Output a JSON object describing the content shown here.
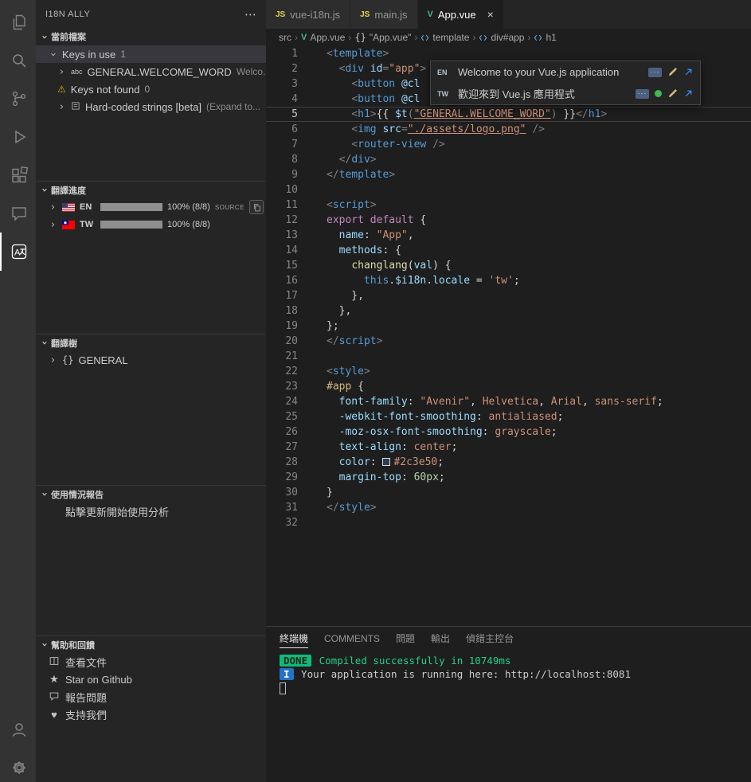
{
  "icons": {
    "chevron": "›",
    "more": "⋯",
    "close": "×",
    "warning": "⚠",
    "star": "★",
    "heart": "♥",
    "braces": "{}",
    "string_symbol": "abc",
    "dots": "···"
  },
  "sidebar": {
    "title": "I18N ALLY",
    "sections": {
      "current_file": {
        "title": "當前檔案",
        "keys_in_use": {
          "label": "Keys in use",
          "count": "1"
        },
        "key": {
          "label": "GENERAL.WELCOME_WORD",
          "desc": "Welco..."
        },
        "keys_not_found": {
          "label": "Keys not found",
          "count": "0"
        },
        "hardcoded": {
          "label": "Hard-coded strings [beta]",
          "desc": "(Expand to..."
        }
      },
      "progress": {
        "title": "翻譯進度",
        "en": {
          "code": "EN",
          "value": "100% (8/8)",
          "tag": "SOURCE"
        },
        "tw": {
          "code": "TW",
          "value": "100% (8/8)"
        }
      },
      "tree": {
        "title": "翻譯樹",
        "root_label": "GENERAL"
      },
      "usage": {
        "title": "使用情況報告",
        "hint": "點擊更新開始使用分析"
      },
      "help": {
        "title": "幫助和回饋",
        "docs": "查看文件",
        "star": "Star on Github",
        "issue": "報告問題",
        "support": "支持我們"
      }
    }
  },
  "editor_tabs": [
    {
      "label": "vue-i18n.js",
      "badge": "JS"
    },
    {
      "label": "main.js",
      "badge": "JS"
    },
    {
      "label": "App.vue",
      "badge": "V"
    }
  ],
  "breadcrumb": [
    "src",
    "App.vue",
    "\"App.vue\"",
    "template",
    "div#app",
    "h1"
  ],
  "popup": {
    "rows": [
      {
        "locale": "EN",
        "text": "Welcome to your Vue.js application"
      },
      {
        "locale": "TW",
        "text": "歡迎來到 Vue.js 應用程式"
      }
    ]
  },
  "editor": {
    "active_line": 5,
    "lines": [
      [
        [
          "pu",
          "<"
        ],
        [
          "tg",
          "template"
        ],
        [
          "pu",
          ">"
        ]
      ],
      [
        [
          "tx",
          "  "
        ],
        [
          "pu",
          "<"
        ],
        [
          "tg",
          "div"
        ],
        [
          "tx",
          " "
        ],
        [
          "at",
          "id"
        ],
        [
          "pu",
          "="
        ],
        [
          "st",
          "\"app\""
        ],
        [
          "pu",
          ">"
        ]
      ],
      [
        [
          "tx",
          "    "
        ],
        [
          "pu",
          "<"
        ],
        [
          "tg",
          "button"
        ],
        [
          "tx",
          " "
        ],
        [
          "at",
          "@cl"
        ]
      ],
      [
        [
          "tx",
          "    "
        ],
        [
          "pu",
          "<"
        ],
        [
          "tg",
          "button"
        ],
        [
          "tx",
          " "
        ],
        [
          "at",
          "@cl"
        ]
      ],
      [
        [
          "tx",
          "    "
        ],
        [
          "pu",
          "<"
        ],
        [
          "tg",
          "h1"
        ],
        [
          "pu",
          ">"
        ],
        [
          "tx",
          "{{ "
        ],
        [
          "at",
          "$t"
        ],
        [
          "pu",
          "("
        ],
        [
          "ku",
          "\"GENERAL.WELCOME_WORD\""
        ],
        [
          "pu",
          ")"
        ],
        [
          "tx",
          " }}"
        ],
        [
          "pu",
          "</"
        ],
        [
          "tg",
          "h1"
        ],
        [
          "pu",
          ">"
        ]
      ],
      [
        [
          "tx",
          "    "
        ],
        [
          "pu",
          "<"
        ],
        [
          "tg",
          "img"
        ],
        [
          "tx",
          " "
        ],
        [
          "at",
          "src"
        ],
        [
          "pu",
          "="
        ],
        [
          "su",
          "\"./assets/logo.png\""
        ],
        [
          "tx",
          " "
        ],
        [
          "pu",
          "/>"
        ]
      ],
      [
        [
          "tx",
          "    "
        ],
        [
          "pu",
          "<"
        ],
        [
          "tg",
          "router-view"
        ],
        [
          "tx",
          " "
        ],
        [
          "pu",
          "/>"
        ]
      ],
      [
        [
          "tx",
          "  "
        ],
        [
          "pu",
          "</"
        ],
        [
          "tg",
          "div"
        ],
        [
          "pu",
          ">"
        ]
      ],
      [
        [
          "pu",
          "</"
        ],
        [
          "tg",
          "template"
        ],
        [
          "pu",
          ">"
        ]
      ],
      [],
      [
        [
          "pu",
          "<"
        ],
        [
          "tg",
          "script"
        ],
        [
          "pu",
          ">"
        ]
      ],
      [
        [
          "kw",
          "export"
        ],
        [
          "tx",
          " "
        ],
        [
          "kw",
          "default"
        ],
        [
          "tx",
          " {"
        ]
      ],
      [
        [
          "tx",
          "  "
        ],
        [
          "at",
          "name"
        ],
        [
          "tx",
          ": "
        ],
        [
          "st",
          "\"App\""
        ],
        [
          "tx",
          ","
        ]
      ],
      [
        [
          "tx",
          "  "
        ],
        [
          "at",
          "methods"
        ],
        [
          "tx",
          ": {"
        ]
      ],
      [
        [
          "tx",
          "    "
        ],
        [
          "fn",
          "changlang"
        ],
        [
          "tx",
          "("
        ],
        [
          "at",
          "val"
        ],
        [
          "tx",
          ") {"
        ]
      ],
      [
        [
          "tx",
          "      "
        ],
        [
          "kb",
          "this"
        ],
        [
          "tx",
          "."
        ],
        [
          "at",
          "$i18n"
        ],
        [
          "tx",
          "."
        ],
        [
          "at",
          "locale"
        ],
        [
          "tx",
          " = "
        ],
        [
          "st",
          "'tw'"
        ],
        [
          "tx",
          ";"
        ]
      ],
      [
        [
          "tx",
          "    },"
        ]
      ],
      [
        [
          "tx",
          "  },"
        ]
      ],
      [
        [
          "tx",
          "};"
        ]
      ],
      [
        [
          "pu",
          "</"
        ],
        [
          "tg",
          "script"
        ],
        [
          "pu",
          ">"
        ]
      ],
      [],
      [
        [
          "pu",
          "<"
        ],
        [
          "tg",
          "style"
        ],
        [
          "pu",
          ">"
        ]
      ],
      [
        [
          "se",
          "#app"
        ],
        [
          "tx",
          " {"
        ]
      ],
      [
        [
          "tx",
          "  "
        ],
        [
          "at",
          "font-family"
        ],
        [
          "tx",
          ": "
        ],
        [
          "st",
          "\"Avenir\""
        ],
        [
          "tx",
          ", "
        ],
        [
          "st",
          "Helvetica"
        ],
        [
          "tx",
          ", "
        ],
        [
          "st",
          "Arial"
        ],
        [
          "tx",
          ", "
        ],
        [
          "st",
          "sans-serif"
        ],
        [
          "tx",
          ";"
        ]
      ],
      [
        [
          "tx",
          "  "
        ],
        [
          "at",
          "-webkit-font-smoothing"
        ],
        [
          "tx",
          ": "
        ],
        [
          "st",
          "antialiased"
        ],
        [
          "tx",
          ";"
        ]
      ],
      [
        [
          "tx",
          "  "
        ],
        [
          "at",
          "-moz-osx-font-smoothing"
        ],
        [
          "tx",
          ": "
        ],
        [
          "st",
          "grayscale"
        ],
        [
          "tx",
          ";"
        ]
      ],
      [
        [
          "tx",
          "  "
        ],
        [
          "at",
          "text-align"
        ],
        [
          "tx",
          ": "
        ],
        [
          "st",
          "center"
        ],
        [
          "tx",
          ";"
        ]
      ],
      [
        [
          "tx",
          "  "
        ],
        [
          "at",
          "color"
        ],
        [
          "tx",
          ": "
        ],
        [
          "sw",
          ""
        ],
        [
          "st",
          "#2c3e50"
        ],
        [
          "tx",
          ";"
        ]
      ],
      [
        [
          "tx",
          "  "
        ],
        [
          "at",
          "margin-top"
        ],
        [
          "tx",
          ": "
        ],
        [
          "nu",
          "60px"
        ],
        [
          "tx",
          ";"
        ]
      ],
      [
        [
          "tx",
          "}"
        ]
      ],
      [
        [
          "pu",
          "</"
        ],
        [
          "tg",
          "style"
        ],
        [
          "pu",
          ">"
        ]
      ],
      []
    ]
  },
  "panel": {
    "tabs": [
      "終端機",
      "COMMENTS",
      "問題",
      "輸出",
      "偵錯主控台"
    ],
    "terminal": {
      "done_badge": "DONE",
      "done_text": " Compiled successfully in 10749ms",
      "info_badge": "I",
      "info_text": " Your application is running here: ",
      "info_link": "http://localhost:8081"
    }
  },
  "colors": {
    "accent_blue": "#3794ff",
    "terminal_green": "#23d18b",
    "badge_green_bg": "#0dbc79",
    "badge_blue_bg": "#2472c8",
    "string_orange": "#ce9178",
    "tag_blue": "#569cd6",
    "selection_bg": "#37373d"
  }
}
